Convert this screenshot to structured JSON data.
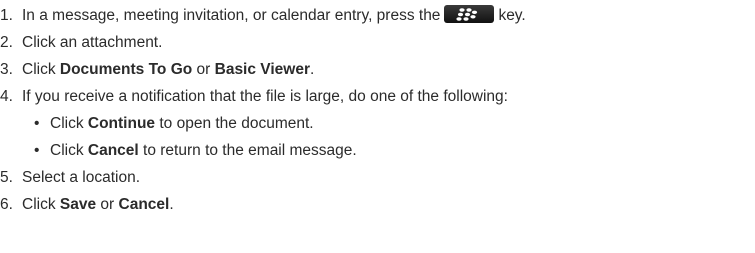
{
  "steps": [
    {
      "num": "1.",
      "before": "In a message, meeting invitation, or calendar entry, press the",
      "key_icon": "blackberry-menu-key-icon",
      "after": "key."
    },
    {
      "num": "2.",
      "text": "Click an attachment."
    },
    {
      "num": "3.",
      "prefix": "Click ",
      "bold1": "Documents To Go",
      "mid": " or ",
      "bold2": "Basic Viewer",
      "suffix": "."
    },
    {
      "num": "4.",
      "text": "If you receive a notification that the file is large, do one of the following:",
      "sub": [
        {
          "bullet": "•",
          "prefix": "Click ",
          "bold": "Continue",
          "suffix": " to open the document."
        },
        {
          "bullet": "•",
          "prefix": "Click ",
          "bold": "Cancel",
          "suffix": " to return to the email message."
        }
      ]
    },
    {
      "num": "5.",
      "text": "Select a location."
    },
    {
      "num": "6.",
      "prefix": "Click ",
      "bold1": "Save",
      "mid": " or ",
      "bold2": "Cancel",
      "suffix": "."
    }
  ]
}
